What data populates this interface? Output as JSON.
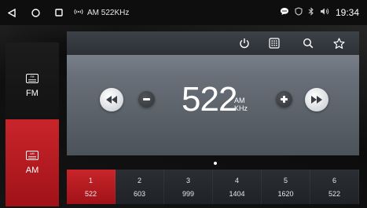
{
  "status_bar": {
    "title": "AM 522KHz",
    "time": "19:34",
    "icons": [
      "back-icon",
      "home-icon",
      "recents-icon",
      "radio-signal-icon",
      "message-icon",
      "shield-icon",
      "bluetooth-icon",
      "volume-icon"
    ]
  },
  "bands": [
    {
      "label": "FM",
      "icon": "fm-radio-icon",
      "active": false
    },
    {
      "label": "AM",
      "icon": "am-radio-icon",
      "active": true
    }
  ],
  "toolbar": {
    "icons": [
      "power-icon",
      "keypad-icon",
      "search-icon",
      "star-icon"
    ]
  },
  "tuner": {
    "frequency": "522",
    "band": "AM",
    "unit": "KHz"
  },
  "presets": [
    {
      "number": "1",
      "freq": "522",
      "active": true
    },
    {
      "number": "2",
      "freq": "603",
      "active": false
    },
    {
      "number": "3",
      "freq": "999",
      "active": false
    },
    {
      "number": "4",
      "freq": "1404",
      "active": false
    },
    {
      "number": "5",
      "freq": "1620",
      "active": false
    },
    {
      "number": "6",
      "freq": "522",
      "active": false
    }
  ],
  "colors": {
    "accent": "#c8252b",
    "panel": "#6a7079",
    "background": "#101010"
  }
}
